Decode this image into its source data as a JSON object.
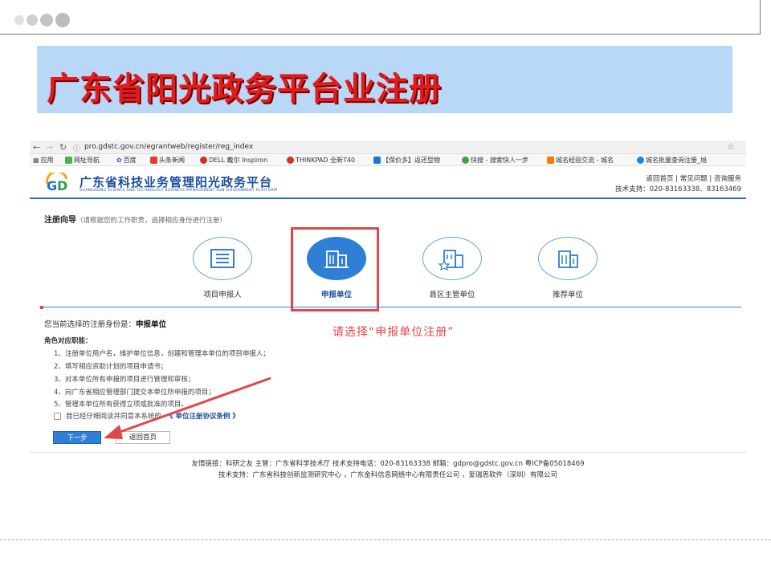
{
  "slide": {
    "title": "广东省阳光政务平台业注册"
  },
  "browser": {
    "url": "pro.gdstc.gov.cn/egrantweb/register/reg_index",
    "bookmarks": [
      "应用",
      "网址导航",
      "百度",
      "头条新闻",
      "DELL 戴尔 Inspiron",
      "THINKPAD 全新T40",
      "【保价多】返还型物",
      "快搜 - 搜索快人一步",
      "城名经验交流 - 城名",
      "城名批量查询注册_旭"
    ]
  },
  "site": {
    "title": "广东省科技业务管理阳光政务平台",
    "subtitle": "GUANGDONG SCIENCE AND TECHNOLOGY BUSINESS MANAGEMENT SUN-GOVERNMENT PLATFORM",
    "links": "返回首页  |  常见问题  |  咨询服务",
    "support": "技术支持：020-83163338、83163469"
  },
  "guide": {
    "title": "注册向导",
    "hint": "（请根据您的工作职责，选择相应身份进行注册）"
  },
  "options": [
    {
      "label": "项目申报人",
      "icon": "id-card-icon",
      "active": false
    },
    {
      "label": "申报单位",
      "icon": "building-icon",
      "active": true
    },
    {
      "label": "县区主管单位",
      "icon": "building-star-icon",
      "active": false
    },
    {
      "label": "推荐单位",
      "icon": "building-icon",
      "active": false
    }
  ],
  "selection": {
    "prefix": "您当前选择的注册身份是：",
    "value": "申报单位"
  },
  "annotation": "请选择“申报单位注册”",
  "duties": {
    "title": "角色对应职能：",
    "items": [
      "1、注册单位用户名，维护单位信息，创建和管理本单位的项目申报人；",
      "2、填写相应资助计划的项目申请书；",
      "3、对本单位所有申报的项目进行管理和审核；",
      "4、向广东省相应管理部门提交本单位所申报的项目；",
      "5、管理本单位所有获得立项或批准的项目。"
    ]
  },
  "agreement": {
    "text": "我已经仔细阅读并同意本系统的",
    "link": "《 单位注册协议条例 》"
  },
  "buttons": {
    "next": "下一步",
    "back": "返回首页"
  },
  "footer": {
    "line1": "友情链接：科研之友    主管：广东省科学技术厅    技术支持电话：020-83163338  邮箱：gdpro@gdstc.gov.cn    粤ICP备05018469",
    "line2": "技术支持：广东省科技创新监测研究中心 ，广东金科信息网络中心有限责任公司 ，爱瑞思软件（深圳）有限公司"
  },
  "colors": {
    "accent": "#2f7fd7",
    "highlight": "#e34646",
    "title": "#e31b1b"
  }
}
